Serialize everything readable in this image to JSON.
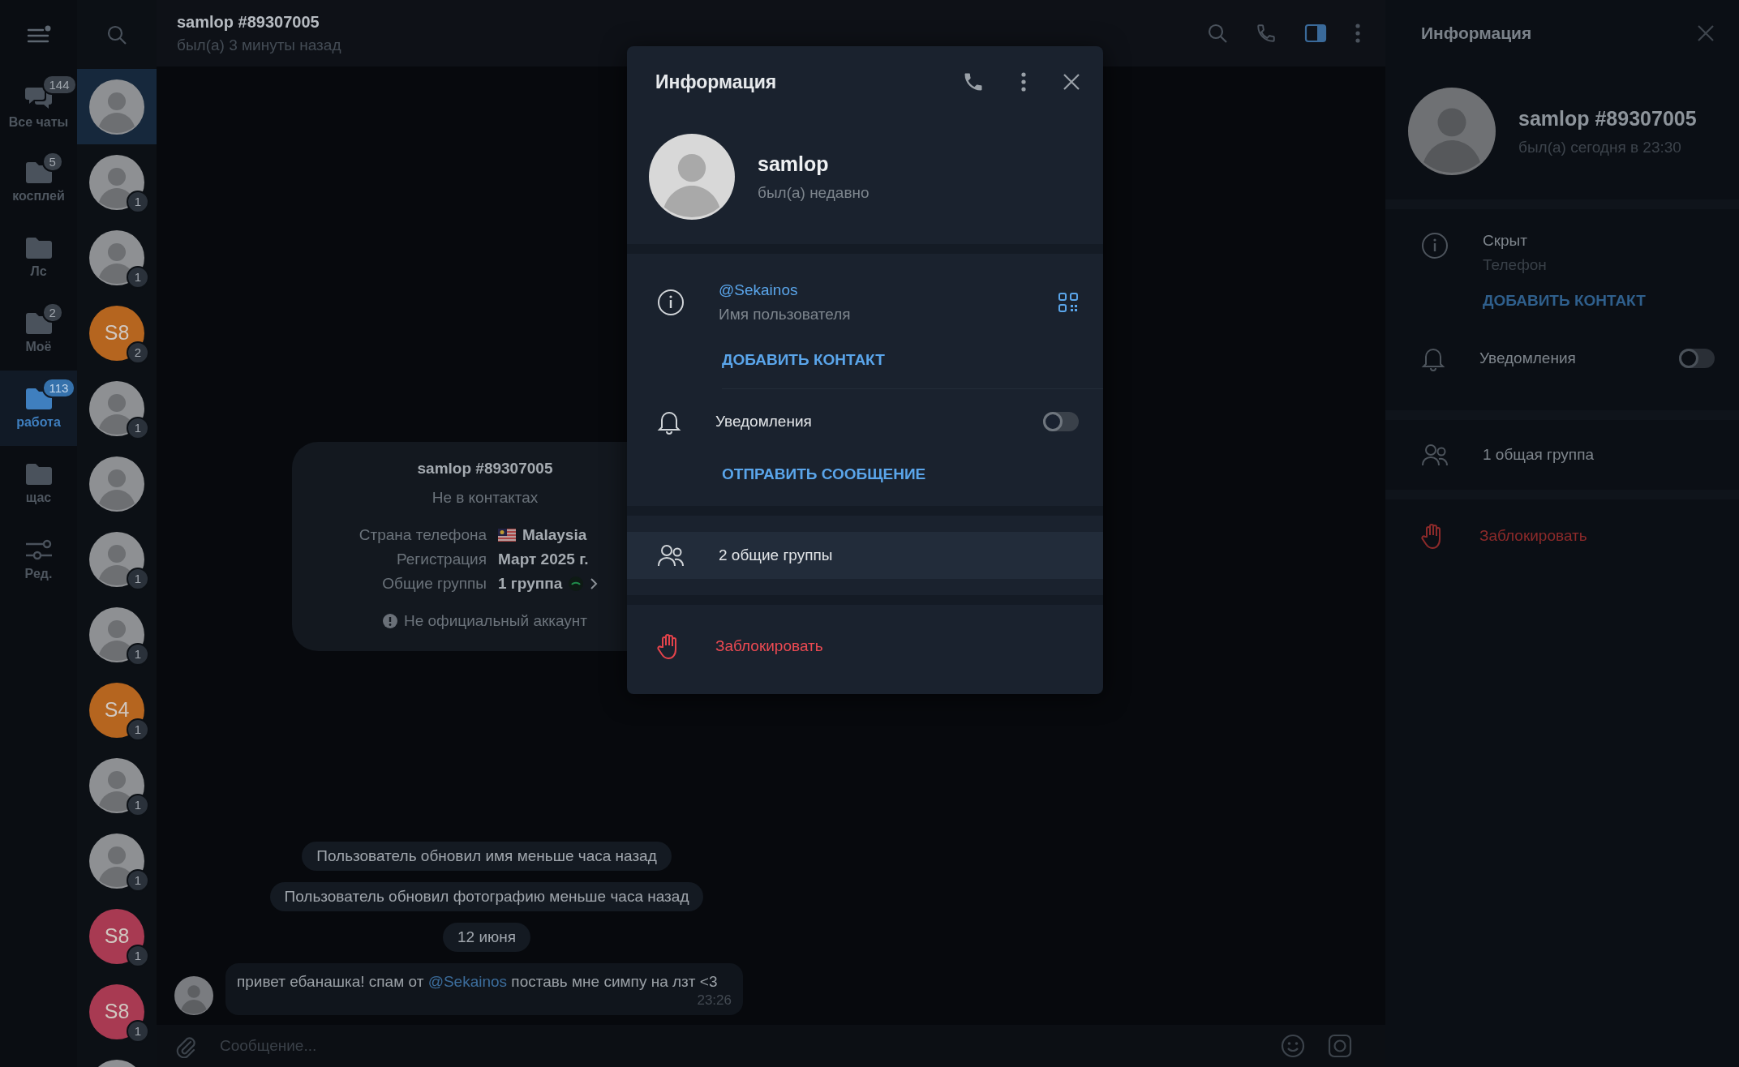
{
  "folders": [
    {
      "kind": "all",
      "label": "Все чаты",
      "badge": "144",
      "selected": false
    },
    {
      "kind": "folder",
      "label": "косплей",
      "badge": "5",
      "selected": false
    },
    {
      "kind": "folder",
      "label": "Лс",
      "selected": false
    },
    {
      "kind": "folder",
      "label": "Моё",
      "badge": "2",
      "selected": false
    },
    {
      "kind": "folder",
      "label": "работа",
      "badge": "113",
      "selected": true
    },
    {
      "kind": "folder",
      "label": "щас",
      "selected": false
    },
    {
      "kind": "edit",
      "label": "Ред.",
      "selected": false
    }
  ],
  "chats": [
    {
      "kind": "photo",
      "selected": true
    },
    {
      "kind": "photo",
      "badge": "1",
      "selected": false
    },
    {
      "kind": "photo",
      "badge": "1",
      "selected": false
    },
    {
      "kind": "initials",
      "initials": "S8",
      "color": "#b5651f",
      "badge": "2",
      "selected": false
    },
    {
      "kind": "photo",
      "badge": "1",
      "selected": false
    },
    {
      "kind": "photo",
      "selected": false
    },
    {
      "kind": "photo",
      "badge": "1",
      "selected": false
    },
    {
      "kind": "photo",
      "badge": "1",
      "selected": false
    },
    {
      "kind": "initials",
      "initials": "S4",
      "color": "#b5651f",
      "badge": "1",
      "selected": false
    },
    {
      "kind": "photo",
      "badge": "1",
      "selected": false
    },
    {
      "kind": "photo",
      "badge": "1",
      "selected": false
    },
    {
      "kind": "initials",
      "initials": "S8",
      "color": "#a83a52",
      "badge": "1",
      "selected": false
    },
    {
      "kind": "initials",
      "initials": "S8",
      "color": "#a83a52",
      "badge": "1",
      "selected": false
    },
    {
      "kind": "photo",
      "selected": false
    }
  ],
  "chat_header": {
    "title": "samlop #89307005",
    "status": "был(а) 3 минуты назад"
  },
  "info_card": {
    "title": "samlop #89307005",
    "subtitle": "Не в контактах",
    "rows": [
      {
        "kind": "country",
        "label": "Страна телефона",
        "value": "Malaysia"
      },
      {
        "kind": "plain",
        "label": "Регистрация",
        "value": "Март 2025 г."
      },
      {
        "kind": "groups",
        "label": "Общие группы",
        "value": "1 группа"
      }
    ],
    "note": "Не официальный аккаунт"
  },
  "service_messages": [
    "Пользователь обновил имя меньше часа назад",
    "Пользователь обновил фотографию меньше часа назад"
  ],
  "date_pill": "12 июня",
  "message": {
    "before": "привет ебанашка! спам от",
    "link": "@Sekainos",
    "after": "поставь мне симпу на лзт <3",
    "time": "23:26"
  },
  "composer": {
    "placeholder": "Сообщение..."
  },
  "modal": {
    "title": "Информация",
    "name": "samlop",
    "status": "был(а) недавно",
    "username": "@Sekainos",
    "username_label": "Имя пользователя",
    "add_contact": "ДОБАВИТЬ КОНТАКТ",
    "notifications": {
      "label": "Уведомления",
      "on": false
    },
    "send_message": "ОТПРАВИТЬ СООБЩЕНИЕ",
    "groups": "2 общие группы",
    "block": "Заблокировать"
  },
  "side_panel": {
    "title": "Информация",
    "name": "samlop #89307005",
    "status": "был(а) сегодня в 23:30",
    "phone": "Скрыт",
    "phone_label": "Телефон",
    "add_contact": "ДОБАВИТЬ КОНТАКТ",
    "notifications": {
      "label": "Уведомления",
      "on": false
    },
    "groups": "1 общая группа",
    "block": "Заблокировать"
  }
}
